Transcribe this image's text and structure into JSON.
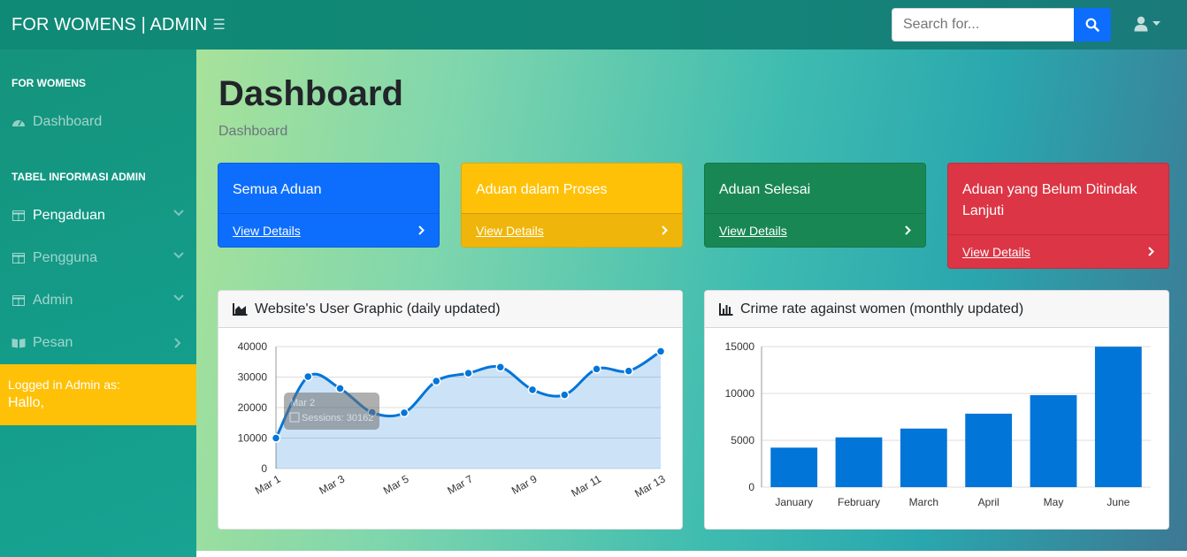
{
  "navbar": {
    "brand": "FOR WOMENS | ADMIN",
    "search_placeholder": "Search for..."
  },
  "sidebar": {
    "heading_main": "FOR WOMENS",
    "dashboard_label": "Dashboard",
    "heading_tables": "TABEL INFORMASI ADMIN",
    "items": [
      {
        "label": "Pengaduan"
      },
      {
        "label": "Pengguna"
      },
      {
        "label": "Admin"
      },
      {
        "label": "Pesan"
      }
    ],
    "footer_line1": "Logged in Admin as:",
    "footer_line2": "Hallo,"
  },
  "main": {
    "title": "Dashboard",
    "breadcrumb": "Dashboard"
  },
  "cards": [
    {
      "label": "Semua Aduan",
      "link": "View Details",
      "color": "#0d6efd"
    },
    {
      "label": "Aduan dalam Proses",
      "link": "View Details",
      "color": "#ffc107"
    },
    {
      "label": "Aduan Selesai",
      "link": "View Details",
      "color": "#198754"
    },
    {
      "label": "Aduan yang Belum Ditindak Lanjuti",
      "link": "View Details",
      "color": "#dc3545"
    }
  ],
  "colors": {
    "accent": "#0d6efd",
    "chart_blue": "#0275d8",
    "sidebar_footer": "#ffc107"
  },
  "area_chart": {
    "title": "Website's User Graphic (daily updated)",
    "tooltip_label": "Mar 2",
    "tooltip_value": "Sessions: 30162"
  },
  "bar_chart": {
    "title": "Crime rate against women (monthly updated)"
  },
  "chart_data": [
    {
      "type": "area",
      "title": "Website's User Graphic (daily updated)",
      "x": [
        "Mar 1",
        "Mar 2",
        "Mar 3",
        "Mar 4",
        "Mar 5",
        "Mar 6",
        "Mar 7",
        "Mar 8",
        "Mar 9",
        "Mar 10",
        "Mar 11",
        "Mar 12",
        "Mar 13"
      ],
      "x_tick_labels": [
        "Mar 1",
        "Mar 3",
        "Mar 5",
        "Mar 7",
        "Mar 9",
        "Mar 11",
        "Mar 13"
      ],
      "series": [
        {
          "values": [
            10000,
            30162,
            26263,
            18394,
            18287,
            28682,
            31274,
            33259,
            25849,
            24159,
            32651,
            31984,
            38451
          ]
        }
      ],
      "ylim": [
        0,
        40000
      ],
      "yticks": [
        0,
        10000,
        20000,
        30000,
        40000
      ],
      "grid": true
    },
    {
      "type": "bar",
      "title": "Crime rate against women (monthly updated)",
      "categories": [
        "January",
        "February",
        "March",
        "April",
        "May",
        "June"
      ],
      "values": [
        4215,
        5312,
        6251,
        7841,
        9821,
        14984
      ],
      "ylim": [
        0,
        15000
      ],
      "yticks": [
        0,
        5000,
        10000,
        15000
      ],
      "grid": true
    }
  ]
}
